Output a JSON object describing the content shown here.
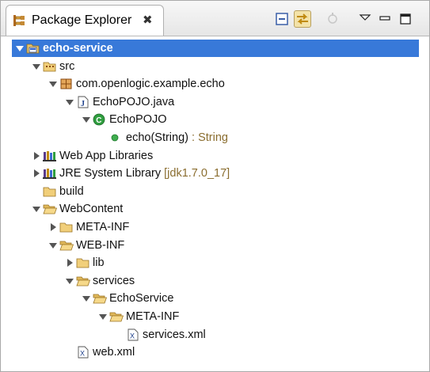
{
  "view": {
    "title": "Package Explorer",
    "close_glyph": "✖",
    "toolbar_icons": [
      "collapse-all-icon",
      "link-with-editor-icon",
      "view-menu-icon",
      "minimize-icon",
      "maximize-icon"
    ]
  },
  "tree": [
    {
      "label": "echo-service",
      "decoration": "",
      "depth": 0,
      "icon": "project-icon",
      "state": "expanded",
      "selected": true
    },
    {
      "label": "src",
      "decoration": "",
      "depth": 1,
      "icon": "source-folder-icon",
      "state": "expanded"
    },
    {
      "label": "com.openlogic.example.echo",
      "decoration": "",
      "depth": 2,
      "icon": "package-icon",
      "state": "expanded"
    },
    {
      "label": "EchoPOJO.java",
      "decoration": "",
      "depth": 3,
      "icon": "java-file-icon",
      "state": "expanded"
    },
    {
      "label": "EchoPOJO",
      "decoration": "",
      "depth": 4,
      "icon": "class-icon",
      "state": "expanded"
    },
    {
      "label": "echo(String)",
      "decoration": " : String",
      "depth": 5,
      "icon": "method-icon",
      "state": "leaf"
    },
    {
      "label": "Web App Libraries",
      "decoration": "",
      "depth": 1,
      "icon": "library-icon",
      "state": "collapsed"
    },
    {
      "label": "JRE System Library",
      "decoration": " [jdk1.7.0_17]",
      "depth": 1,
      "icon": "library-icon",
      "state": "collapsed"
    },
    {
      "label": "build",
      "decoration": "",
      "depth": 1,
      "icon": "folder-icon",
      "state": "leaf"
    },
    {
      "label": "WebContent",
      "decoration": "",
      "depth": 1,
      "icon": "folder-open-icon",
      "state": "expanded"
    },
    {
      "label": "META-INF",
      "decoration": "",
      "depth": 2,
      "icon": "folder-icon",
      "state": "collapsed"
    },
    {
      "label": "WEB-INF",
      "decoration": "",
      "depth": 2,
      "icon": "folder-open-icon",
      "state": "expanded"
    },
    {
      "label": "lib",
      "decoration": "",
      "depth": 3,
      "icon": "folder-icon",
      "state": "collapsed"
    },
    {
      "label": "services",
      "decoration": "",
      "depth": 3,
      "icon": "folder-open-icon",
      "state": "expanded"
    },
    {
      "label": "EchoService",
      "decoration": "",
      "depth": 4,
      "icon": "folder-open-icon",
      "state": "expanded"
    },
    {
      "label": "META-INF",
      "decoration": "",
      "depth": 5,
      "icon": "folder-open-icon",
      "state": "expanded"
    },
    {
      "label": "services.xml",
      "decoration": "",
      "depth": 6,
      "icon": "xml-file-icon",
      "state": "leaf"
    },
    {
      "label": "web.xml",
      "decoration": "",
      "depth": 3,
      "icon": "xml-file-icon",
      "state": "leaf"
    }
  ]
}
